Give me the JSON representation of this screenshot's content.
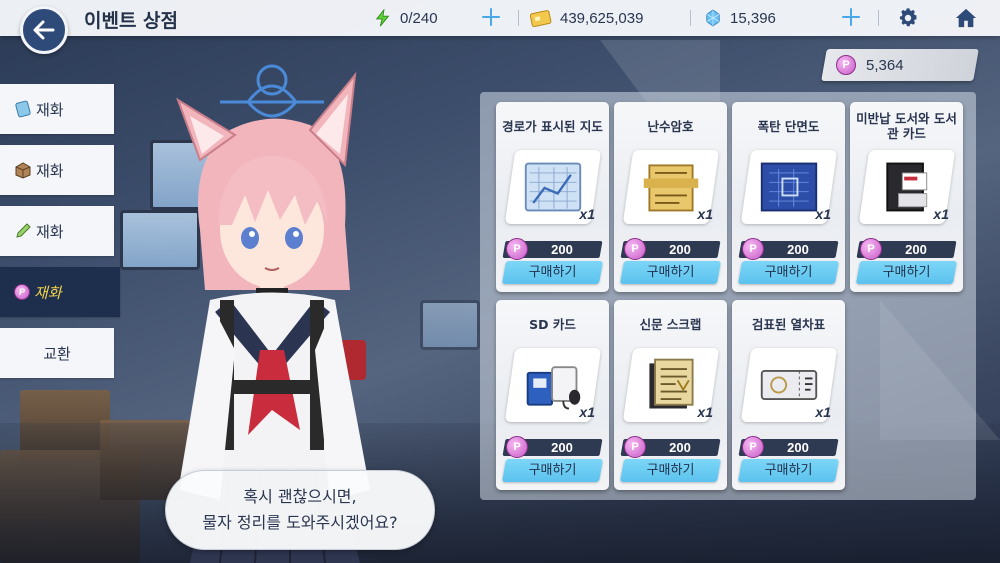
{
  "header": {
    "title": "이벤트 상점",
    "back_icon": "arrow-left-icon"
  },
  "resources": {
    "ap": {
      "icon": "lightning-icon",
      "value": "0/240",
      "color": "#5fd23a"
    },
    "credits": {
      "icon": "credit-card-icon",
      "value": "439,625,039",
      "color": "#f2c94c"
    },
    "gems": {
      "icon": "crystal-icon",
      "value": "15,396",
      "color": "#4aa8e8"
    }
  },
  "event_currency": {
    "icon": "p-coin-icon",
    "label": "P",
    "amount": "5,364"
  },
  "sidebar": {
    "items": [
      {
        "label": "재화",
        "icon": "blue-card-icon"
      },
      {
        "label": "재화",
        "icon": "box-icon"
      },
      {
        "label": "재화",
        "icon": "pencil-icon"
      },
      {
        "label": "재화",
        "icon": "p-coin-icon",
        "active": true
      },
      {
        "label": "교환"
      }
    ]
  },
  "dialogue": {
    "line1": "혹시 괜찮으시면,",
    "line2": "물자 정리를 도와주시겠어요?"
  },
  "shop": {
    "items": [
      {
        "name": "경로가 표시된 지도",
        "qty": "x1",
        "price": "200",
        "buy": "구매하기",
        "icon": "map-icon"
      },
      {
        "name": "난수암호",
        "qty": "x1",
        "price": "200",
        "buy": "구매하기",
        "icon": "cipher-scroll-icon"
      },
      {
        "name": "폭탄 단면도",
        "qty": "x1",
        "price": "200",
        "buy": "구매하기",
        "icon": "blueprint-icon"
      },
      {
        "name": "미반납 도서와 도서관 카드",
        "qty": "x1",
        "price": "200",
        "buy": "구매하기",
        "icon": "book-icon"
      },
      {
        "name": "SD 카드",
        "qty": "x1",
        "price": "200",
        "buy": "구매하기",
        "icon": "sd-card-icon"
      },
      {
        "name": "신문 스크랩",
        "qty": "x1",
        "price": "200",
        "buy": "구매하기",
        "icon": "newspaper-icon"
      },
      {
        "name": "검표된 열차표",
        "qty": "x1",
        "price": "200",
        "buy": "구매하기",
        "icon": "ticket-icon"
      }
    ],
    "price_coin": "P"
  },
  "colors": {
    "accent": "#5bc2ee",
    "nav_dark": "#1e2f4e",
    "active_text": "#f2d24a",
    "price_bar": "#2e3a52"
  }
}
